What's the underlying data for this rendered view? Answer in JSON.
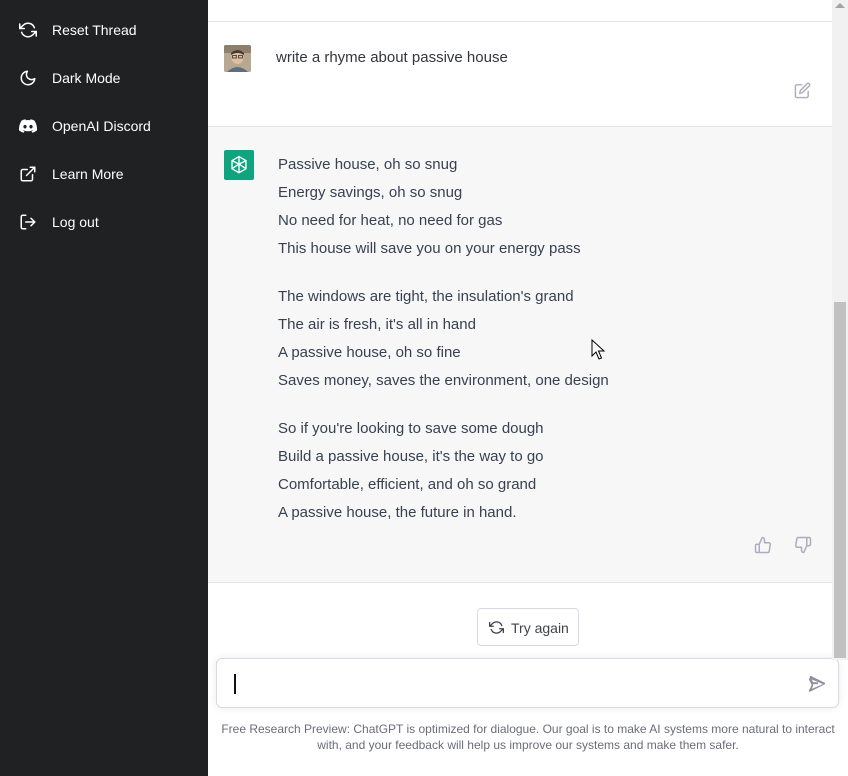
{
  "sidebar": {
    "items": [
      {
        "label": "Reset Thread",
        "icon": "reset-icon"
      },
      {
        "label": "Dark Mode",
        "icon": "moon-icon"
      },
      {
        "label": "OpenAI Discord",
        "icon": "discord-icon"
      },
      {
        "label": "Learn More",
        "icon": "external-link-icon"
      },
      {
        "label": "Log out",
        "icon": "logout-icon"
      }
    ]
  },
  "conversation": {
    "user_message": "write a rhyme about passive house",
    "assistant_stanzas": [
      [
        "Passive house, oh so snug",
        "Energy savings, oh so snug",
        "No need for heat, no need for gas",
        "This house will save you on your energy pass"
      ],
      [
        "The windows are tight, the insulation's grand",
        "The air is fresh, it's all in hand",
        "A passive house, oh so fine",
        "Saves money, saves the environment, one design"
      ],
      [
        "So if you're looking to save some dough",
        "Build a passive house, it's the way to go",
        "Comfortable, efficient, and oh so grand",
        "A passive house, the future in hand."
      ]
    ]
  },
  "actions": {
    "try_again_label": "Try again"
  },
  "composer": {
    "value": ""
  },
  "footer": {
    "text": "Free Research Preview: ChatGPT is optimized for dialogue. Our goal is to make AI systems more natural to interact with, and your feedback will help us improve our systems and make them safer."
  },
  "colors": {
    "sidebar_bg": "#202123",
    "assistant_row_bg": "#f7f7f8",
    "assistant_avatar_bg": "#10a37f"
  }
}
